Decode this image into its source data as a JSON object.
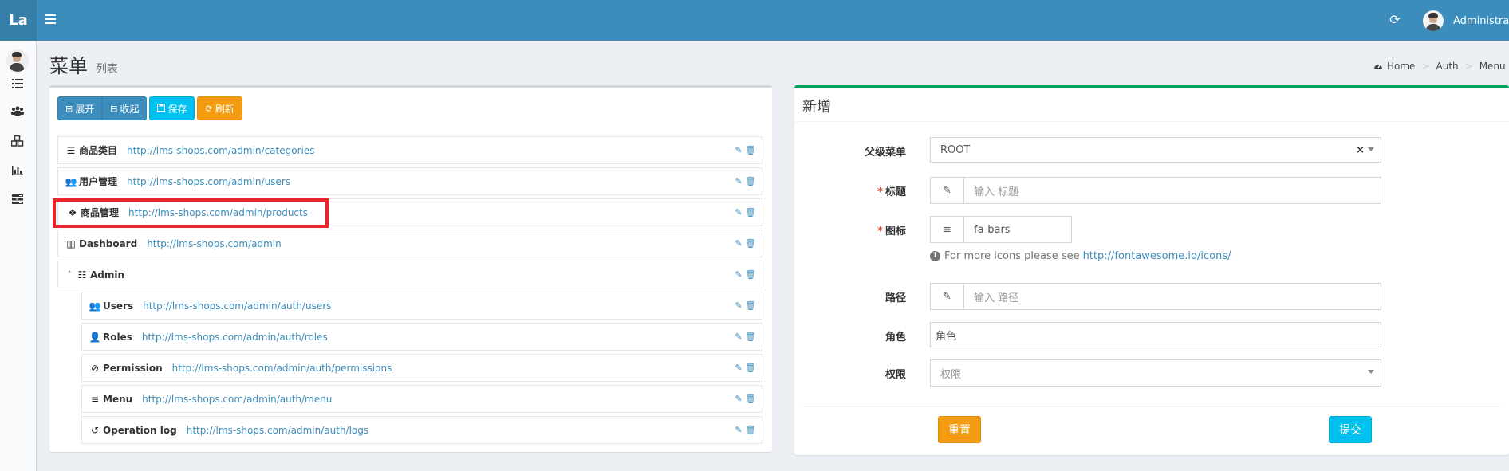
{
  "header": {
    "logo": "La",
    "user_name": "Administrator"
  },
  "content": {
    "title": "菜单",
    "subtitle": "列表"
  },
  "breadcrumb": [
    "Home",
    "Auth",
    "Menu"
  ],
  "toolbar": {
    "expand": "展开",
    "collapse": "收起",
    "save": "保存",
    "refresh": "刷新"
  },
  "tree": [
    {
      "title": "商品类目",
      "url": "http://lms-shops.com/admin/categories",
      "icon": "list-icon"
    },
    {
      "title": "用户管理",
      "url": "http://lms-shops.com/admin/users",
      "icon": "users-icon"
    },
    {
      "title": "商品管理",
      "url": "http://lms-shops.com/admin/products",
      "icon": "cubes-icon"
    },
    {
      "title": "Dashboard",
      "url": "http://lms-shops.com/admin",
      "icon": "bar-chart-icon"
    },
    {
      "title": "Admin",
      "url": "",
      "icon": "tasks-icon"
    },
    {
      "title": "Users",
      "url": "http://lms-shops.com/admin/auth/users",
      "icon": "users-icon"
    },
    {
      "title": "Roles",
      "url": "http://lms-shops.com/admin/auth/roles",
      "icon": "user-icon"
    },
    {
      "title": "Permission",
      "url": "http://lms-shops.com/admin/auth/permissions",
      "icon": "ban-icon"
    },
    {
      "title": "Menu",
      "url": "http://lms-shops.com/admin/auth/menu",
      "icon": "bars-icon"
    },
    {
      "title": "Operation log",
      "url": "http://lms-shops.com/admin/auth/logs",
      "icon": "history-icon"
    }
  ],
  "form": {
    "title": "新增",
    "parent_label": "父级菜单",
    "parent_value": "ROOT",
    "title_label": "标题",
    "title_placeholder": "输入 标题",
    "icon_label": "图标",
    "icon_value": "fa-bars",
    "help_text": "For more icons please see",
    "help_link": "http://fontawesome.io/icons/",
    "path_label": "路径",
    "path_placeholder": "输入 路径",
    "role_label": "角色",
    "role_placeholder": "角色",
    "permission_label": "权限",
    "permission_placeholder": "权限",
    "reset": "重置",
    "submit": "提交"
  },
  "colors": {
    "header": "#3c8dbc",
    "primary": "#3c8dbc",
    "info": "#00c0ef",
    "warning": "#f39c12",
    "success_border": "#00a65a",
    "highlight": "#e8262c"
  }
}
